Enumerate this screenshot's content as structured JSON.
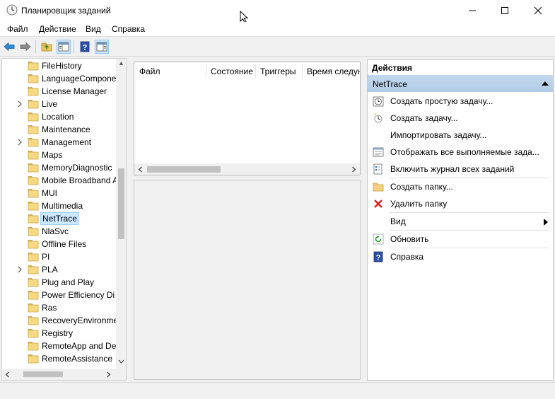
{
  "window": {
    "title": "Планировщик заданий"
  },
  "menu": [
    {
      "label": "Файл"
    },
    {
      "label": "Действие"
    },
    {
      "label": "Вид"
    },
    {
      "label": "Справка"
    }
  ],
  "toolbar": {
    "back_icon": "back-arrow-icon",
    "forward_icon": "forward-arrow-icon",
    "up_icon": "folder-up-icon",
    "show_hide_tree_icon": "console-tree-icon",
    "help_icon": "help-icon",
    "action_pane_icon": "action-pane-icon"
  },
  "tree": {
    "items": [
      {
        "label": "FileHistory",
        "expandable": false,
        "selected": false
      },
      {
        "label": "LanguageCompone",
        "expandable": false,
        "selected": false
      },
      {
        "label": "License Manager",
        "expandable": false,
        "selected": false
      },
      {
        "label": "Live",
        "expandable": true,
        "selected": false
      },
      {
        "label": "Location",
        "expandable": false,
        "selected": false
      },
      {
        "label": "Maintenance",
        "expandable": false,
        "selected": false
      },
      {
        "label": "Management",
        "expandable": true,
        "selected": false
      },
      {
        "label": "Maps",
        "expandable": false,
        "selected": false
      },
      {
        "label": "MemoryDiagnostic",
        "expandable": false,
        "selected": false
      },
      {
        "label": "Mobile Broadband A",
        "expandable": false,
        "selected": false
      },
      {
        "label": "MUI",
        "expandable": false,
        "selected": false
      },
      {
        "label": "Multimedia",
        "expandable": false,
        "selected": false
      },
      {
        "label": "NetTrace",
        "expandable": false,
        "selected": true
      },
      {
        "label": "NlaSvc",
        "expandable": false,
        "selected": false
      },
      {
        "label": "Offline Files",
        "expandable": false,
        "selected": false
      },
      {
        "label": "PI",
        "expandable": false,
        "selected": false
      },
      {
        "label": "PLA",
        "expandable": true,
        "selected": false
      },
      {
        "label": "Plug and Play",
        "expandable": false,
        "selected": false
      },
      {
        "label": "Power Efficiency Di",
        "expandable": false,
        "selected": false
      },
      {
        "label": "Ras",
        "expandable": false,
        "selected": false
      },
      {
        "label": "RecoveryEnvironme",
        "expandable": false,
        "selected": false
      },
      {
        "label": "Registry",
        "expandable": false,
        "selected": false
      },
      {
        "label": "RemoteApp and De",
        "expandable": false,
        "selected": false
      },
      {
        "label": "RemoteAssistance",
        "expandable": false,
        "selected": false
      }
    ]
  },
  "task_list": {
    "columns": [
      "Файл",
      "Состояние",
      "Триггеры",
      "Время следую"
    ]
  },
  "actions": {
    "title": "Действия",
    "group": "NetTrace",
    "items": [
      {
        "label": "Создать простую задачу...",
        "icon": "create-basic-task-icon"
      },
      {
        "label": "Создать задачу...",
        "icon": "create-task-icon"
      },
      {
        "label": "Импортировать задачу...",
        "icon": ""
      },
      {
        "label": "Отображать все выполняемые зада...",
        "icon": "running-tasks-icon"
      },
      {
        "label": "Включить журнал всех заданий",
        "icon": "history-log-icon"
      },
      {
        "label": "Создать папку...",
        "icon": "new-folder-icon"
      },
      {
        "label": "Удалить папку",
        "icon": "delete-icon"
      },
      {
        "label": "Вид",
        "icon": "",
        "submenu": true
      },
      {
        "label": "Обновить",
        "icon": "refresh-icon"
      },
      {
        "label": "Справка",
        "icon": "help-icon"
      }
    ]
  }
}
